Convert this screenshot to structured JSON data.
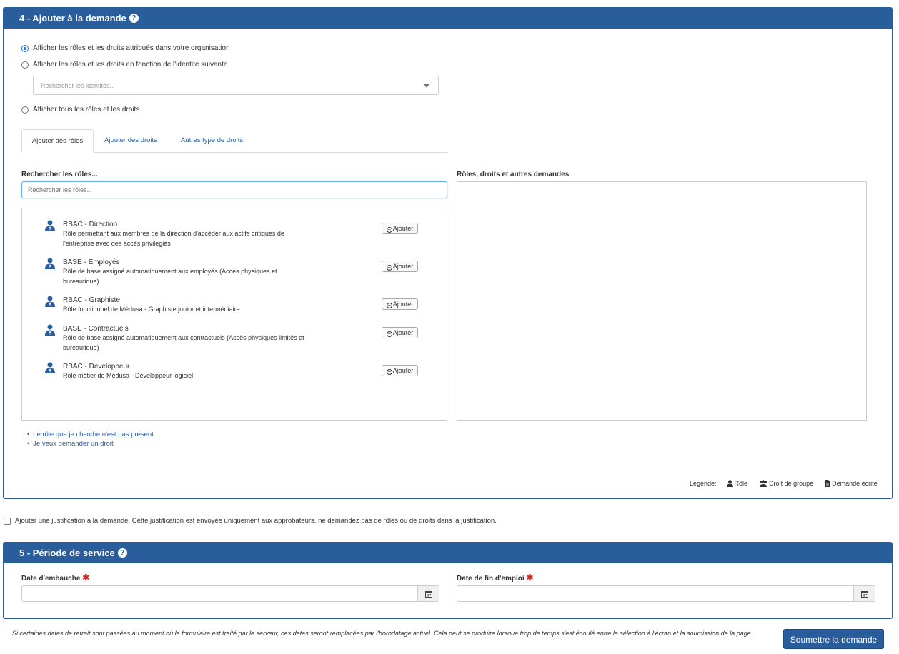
{
  "section4": {
    "title": "4 - Ajouter à la demande",
    "radio_options": [
      {
        "label": "Afficher les rôles et les droits attribués dans votre organisation",
        "selected": true
      },
      {
        "label": "Afficher les rôles et les droits en fonction de l'identité suivante",
        "selected": false
      },
      {
        "label": "Afficher tous les rôles et les droits",
        "selected": false
      }
    ],
    "identity_select_placeholder": "Rechercher les identités...",
    "tabs": [
      {
        "label": "Ajouter des rôles",
        "active": true
      },
      {
        "label": "Ajouter des droits",
        "active": false
      },
      {
        "label": "Autres type de droits",
        "active": false
      }
    ],
    "search_label": "Rechercher les rôles...",
    "search_placeholder": "Rechercher les rôles...",
    "requests_label": "Rôles, droits et autres demandes",
    "add_button_label": "Ajouter",
    "roles": [
      {
        "name": "RBAC - Direction",
        "description": "Rôle permettant aux membres de la direction d'accéder aux actifs critiques de l'entreprise avec des accès privilégiés"
      },
      {
        "name": "BASE - Employés",
        "description": "Rôle de base assigné automatiquement aux employés (Accès physiques et bureautique)"
      },
      {
        "name": "RBAC - Graphiste",
        "description": "Rôle fonctionnel de Médusa - Graphiste junior et intermédiaire"
      },
      {
        "name": "BASE - Contractuels",
        "description": "Rôle de base assigné automatiquement aux contractuels (Accès physiques limités et bureautique)"
      },
      {
        "name": "RBAC - Développeur",
        "description": "Role métier de Médusa - Développeur logiciel"
      }
    ],
    "links": [
      "Le rôle que je cherche n'est pas présent",
      "Je veux demander un droit"
    ],
    "legend": {
      "label": "Légende:",
      "role": "Rôle",
      "group_right": "Droit de groupe",
      "written_request": "Demande écrite"
    }
  },
  "justification": {
    "label": "Ajouter une justification à la demande. Cette justification est envoyée uniquement aux approbateurs, ne demandez pas de rôles ou de droits dans la justification.",
    "checked": false
  },
  "section5": {
    "title": "5 - Période de service",
    "hire_date_label": "Date d'embauche",
    "end_date_label": "Date de fin d'emploi",
    "required_marker": "✱"
  },
  "footer": {
    "note": "Si certaines dates de retrait sont passées au moment où le formulaire est traité par le serveur, ces dates seront remplacées par l'horodatage actuel. Cela peut se produire lorsque trop de temps s'est écoulé entre la sélection à l'écran et la soumission de la page.",
    "submit_label": "Soumettre la demande"
  },
  "colors": {
    "brand": "#2a5d9c",
    "required": "#c9302c"
  }
}
